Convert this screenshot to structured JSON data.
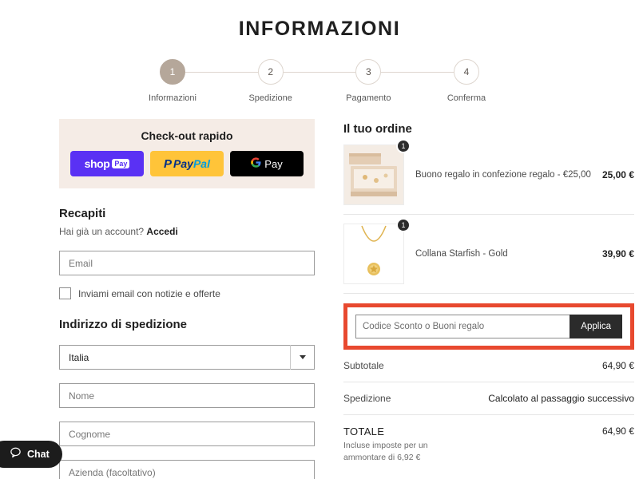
{
  "page": {
    "title": "INFORMAZIONI"
  },
  "stepper": {
    "steps": [
      {
        "number": "1",
        "label": "Informazioni",
        "active": true
      },
      {
        "number": "2",
        "label": "Spedizione",
        "active": false
      },
      {
        "number": "3",
        "label": "Pagamento",
        "active": false
      },
      {
        "number": "4",
        "label": "Conferma",
        "active": false
      }
    ],
    "active_color": "#b5a79a",
    "line_color": "#ded6cf"
  },
  "quick_checkout": {
    "title": "Check-out rapido",
    "background": "#f5ece6",
    "buttons": [
      {
        "name": "shop-pay",
        "word": "shop",
        "chip": "Pay",
        "color": "#5a31f4"
      },
      {
        "name": "paypal",
        "mark": "P",
        "pay": "Pay",
        "pal": "Pal",
        "color": "#ffc439"
      },
      {
        "name": "google-pay",
        "mark": "G",
        "pay": "Pay",
        "color": "#000000"
      }
    ]
  },
  "contacts": {
    "heading": "Recapiti",
    "account_prompt": "Hai già un account?",
    "login_link": "Accedi",
    "email_placeholder": "Email",
    "email_value": "",
    "newsletter_label": "Inviami email con notizie e offerte",
    "newsletter_checked": false
  },
  "shipping": {
    "heading": "Indirizzo di spedizione",
    "country_value": "Italia",
    "fields": [
      {
        "name": "first-name",
        "placeholder": "Nome",
        "value": ""
      },
      {
        "name": "last-name",
        "placeholder": "Cognome",
        "value": ""
      },
      {
        "name": "company",
        "placeholder": "Azienda (facoltativo)",
        "value": ""
      }
    ]
  },
  "order": {
    "title": "Il tuo ordine",
    "items": [
      {
        "name": "Buono regalo in confezione regalo -  €25,00",
        "price": "25,00 €",
        "qty": "1",
        "thumb": "gift-box-photo"
      },
      {
        "name": "Collana Starfish -  Gold",
        "price": "39,90 €",
        "qty": "1",
        "thumb": "necklace-photo"
      }
    ],
    "discount": {
      "placeholder": "Codice Sconto o Buoni regalo",
      "value": "",
      "button_label": "Applica",
      "highlight_color": "#e8492f",
      "button_color": "#2b2b2b"
    },
    "subtotal_label": "Subtotale",
    "subtotal_value": "64,90 €",
    "shipping_label": "Spedizione",
    "shipping_value": "Calcolato al passaggio successivo",
    "total_label": "TOTALE",
    "total_note": "Incluse imposte per un ammontare di 6,92 €",
    "total_value": "64,90 €"
  },
  "chat": {
    "label": "Chat",
    "icon": "speech-bubble-icon"
  }
}
